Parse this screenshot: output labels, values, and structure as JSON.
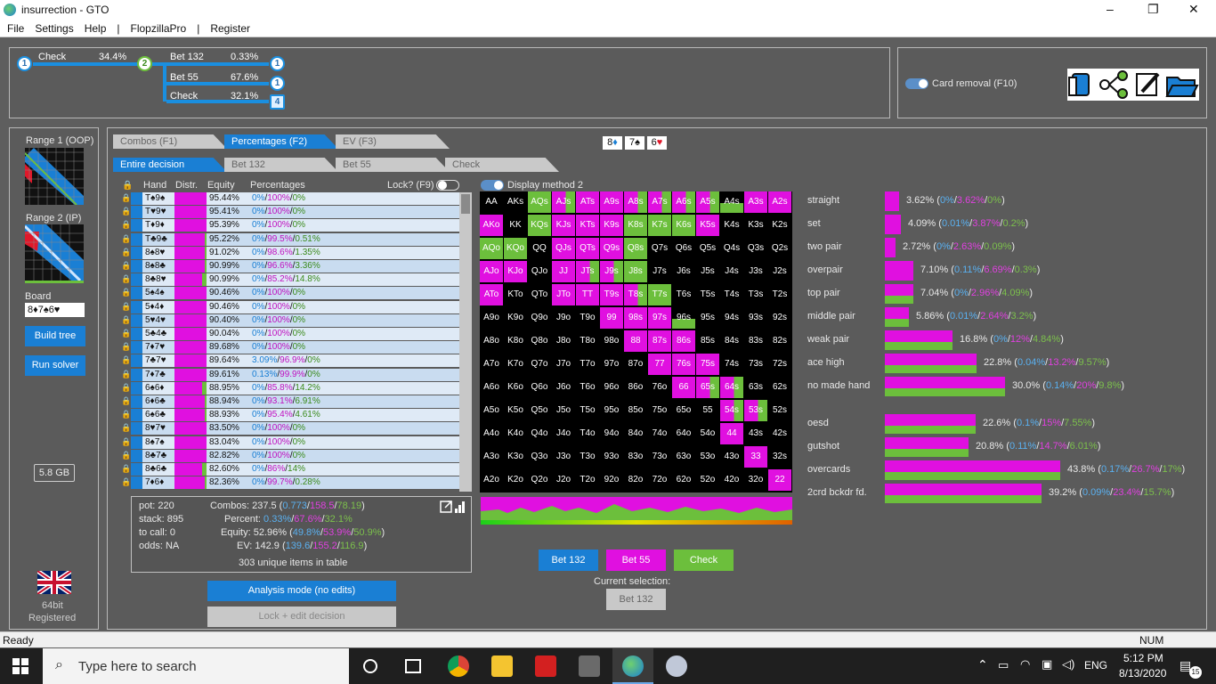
{
  "window": {
    "title": "insurrection - GTO",
    "min": "–",
    "max": "❐",
    "close": "✕"
  },
  "menu": [
    "File",
    "Settings",
    "Help",
    "|",
    "FlopzillaPro",
    "|",
    "Register"
  ],
  "tree": {
    "root_action": "Check",
    "root_freq": "34.4%",
    "node1": "1",
    "node2": "2",
    "branches": [
      {
        "label": "Bet 132",
        "freq": "0.33%",
        "node": "1"
      },
      {
        "label": "Bet 55",
        "freq": "67.6%",
        "node": "1"
      },
      {
        "label": "Check",
        "freq": "32.1%",
        "node": "4"
      }
    ]
  },
  "card_removal": "Card removal (F10)",
  "left": {
    "range1": "Range 1 (OOP)",
    "range2": "Range 2 (IP)",
    "board_label": "Board",
    "board_value": "8♦7♠6♥",
    "build_tree": "Build tree",
    "run_solver": "Run solver",
    "memory": "5.8 GB",
    "bit": "64bit",
    "registered": "Registered"
  },
  "tabs1": [
    "Combos (F1)",
    "Percentages (F2)",
    "EV (F3)"
  ],
  "tabs2": [
    "Entire decision",
    "Bet 132",
    "Bet 55",
    "Check"
  ],
  "board_cards": [
    {
      "rank": "8",
      "suit": "♦",
      "color": "#1a7fd4"
    },
    {
      "rank": "7",
      "suit": "♠",
      "color": "#111"
    },
    {
      "rank": "6",
      "suit": "♥",
      "color": "#e0182a"
    }
  ],
  "table": {
    "headers": [
      "Hand",
      "Distr.",
      "Equity",
      "Percentages",
      "Lock? (F9)"
    ],
    "rows": [
      {
        "hand": "T♠9♠",
        "eq": "95.44%",
        "p": [
          "0%",
          "100%",
          "0%"
        ]
      },
      {
        "hand": "T♥9♥",
        "eq": "95.41%",
        "p": [
          "0%",
          "100%",
          "0%"
        ]
      },
      {
        "hand": "T♦9♦",
        "eq": "95.39%",
        "p": [
          "0%",
          "100%",
          "0%"
        ]
      },
      {
        "hand": "T♣9♣",
        "eq": "95.22%",
        "p": [
          "0%",
          "99.5%",
          "0.51%"
        ]
      },
      {
        "hand": "8♠8♥",
        "eq": "91.02%",
        "p": [
          "0%",
          "98.6%",
          "1.35%"
        ]
      },
      {
        "hand": "8♠8♣",
        "eq": "90.99%",
        "p": [
          "0%",
          "96.6%",
          "3.36%"
        ]
      },
      {
        "hand": "8♣8♥",
        "eq": "90.99%",
        "p": [
          "0%",
          "85.2%",
          "14.8%"
        ]
      },
      {
        "hand": "5♠4♠",
        "eq": "90.46%",
        "p": [
          "0%",
          "100%",
          "0%"
        ]
      },
      {
        "hand": "5♦4♦",
        "eq": "90.46%",
        "p": [
          "0%",
          "100%",
          "0%"
        ]
      },
      {
        "hand": "5♥4♥",
        "eq": "90.40%",
        "p": [
          "0%",
          "100%",
          "0%"
        ]
      },
      {
        "hand": "5♣4♣",
        "eq": "90.04%",
        "p": [
          "0%",
          "100%",
          "0%"
        ]
      },
      {
        "hand": "7♦7♥",
        "eq": "89.68%",
        "p": [
          "0%",
          "100%",
          "0%"
        ]
      },
      {
        "hand": "7♣7♥",
        "eq": "89.64%",
        "p": [
          "3.09%",
          "96.9%",
          "0%"
        ]
      },
      {
        "hand": "7♦7♣",
        "eq": "89.61%",
        "p": [
          "0.13%",
          "99.9%",
          "0%"
        ]
      },
      {
        "hand": "6♠6♦",
        "eq": "88.95%",
        "p": [
          "0%",
          "85.8%",
          "14.2%"
        ]
      },
      {
        "hand": "6♦6♣",
        "eq": "88.94%",
        "p": [
          "0%",
          "93.1%",
          "6.91%"
        ]
      },
      {
        "hand": "6♠6♣",
        "eq": "88.93%",
        "p": [
          "0%",
          "95.4%",
          "4.61%"
        ]
      },
      {
        "hand": "8♥7♥",
        "eq": "83.50%",
        "p": [
          "0%",
          "100%",
          "0%"
        ]
      },
      {
        "hand": "8♠7♠",
        "eq": "83.04%",
        "p": [
          "0%",
          "100%",
          "0%"
        ]
      },
      {
        "hand": "8♣7♣",
        "eq": "82.82%",
        "p": [
          "0%",
          "100%",
          "0%"
        ]
      },
      {
        "hand": "8♣6♣",
        "eq": "82.60%",
        "p": [
          "0%",
          "86%",
          "14%"
        ]
      },
      {
        "hand": "7♦6♦",
        "eq": "82.36%",
        "p": [
          "0%",
          "99.7%",
          "0.28%"
        ]
      }
    ]
  },
  "summary": {
    "pot": "pot: 220",
    "stack": "stack: 895",
    "tocall": "to call: 0",
    "odds": "odds: NA",
    "combos_lbl": "Combos:",
    "combos_total": "237.5",
    "combos": [
      "0.773",
      "158.5",
      "78.19"
    ],
    "percent_lbl": "Percent:",
    "percent": [
      "0.33%",
      "67.6%",
      "32.1%"
    ],
    "equity_lbl": "Equity:",
    "equity_total": "52.96%",
    "equity": [
      "49.8%",
      "53.9%",
      "50.9%"
    ],
    "ev_lbl": "EV:",
    "ev_total": "142.9",
    "ev": [
      "139.6",
      "155.2",
      "116.9"
    ],
    "unique": "303 unique items in table"
  },
  "analysis_btn": "Analysis mode (no edits)",
  "lock_btn": "Lock + edit decision",
  "display_method": "Display method 2",
  "grid_ranks": [
    "A",
    "K",
    "Q",
    "J",
    "T",
    "9",
    "8",
    "7",
    "6",
    "5",
    "4",
    "3",
    "2"
  ],
  "legend": {
    "bet132": "Bet 132",
    "bet55": "Bet 55",
    "check": "Check",
    "current": "Current selection:",
    "current_value": "Bet 132"
  },
  "colors": {
    "bet132": "#1a7fd4",
    "bet55": "#e010e0",
    "check": "#6cbf3c"
  },
  "stats": [
    {
      "name": "straight",
      "total": "3.62%",
      "p": [
        "0%",
        "3.62%",
        "0%"
      ],
      "frac": 0.036
    },
    {
      "name": "set",
      "total": "4.09%",
      "p": [
        "0.01%",
        "3.87%",
        "0.2%"
      ],
      "frac": 0.041
    },
    {
      "name": "two pair",
      "total": "2.72%",
      "p": [
        "0%",
        "2.63%",
        "0.09%"
      ],
      "frac": 0.027
    },
    {
      "name": "overpair",
      "total": "7.10%",
      "p": [
        "0.11%",
        "6.69%",
        "0.3%"
      ],
      "frac": 0.071
    },
    {
      "name": "top pair",
      "total": "7.04%",
      "p": [
        "0%",
        "2.96%",
        "4.09%"
      ],
      "frac": 0.07
    },
    {
      "name": "middle pair",
      "total": "5.86%",
      "p": [
        "0.01%",
        "2.64%",
        "3.2%"
      ],
      "frac": 0.059
    },
    {
      "name": "weak pair",
      "total": "16.8%",
      "p": [
        "0%",
        "12%",
        "4.84%"
      ],
      "frac": 0.168
    },
    {
      "name": "ace high",
      "total": "22.8%",
      "p": [
        "0.04%",
        "13.2%",
        "9.57%"
      ],
      "frac": 0.228
    },
    {
      "name": "no made hand",
      "total": "30.0%",
      "p": [
        "0.14%",
        "20%",
        "9.8%"
      ],
      "frac": 0.3
    },
    {
      "name": "oesd",
      "total": "22.6%",
      "p": [
        "0.1%",
        "15%",
        "7.55%"
      ],
      "frac": 0.226
    },
    {
      "name": "gutshot",
      "total": "20.8%",
      "p": [
        "0.11%",
        "14.7%",
        "6.01%"
      ],
      "frac": 0.208
    },
    {
      "name": "overcards",
      "total": "43.8%",
      "p": [
        "0.17%",
        "26.7%",
        "17%"
      ],
      "frac": 0.438
    },
    {
      "name": "2crd bckdr fd.",
      "total": "39.2%",
      "p": [
        "0.09%",
        "23.4%",
        "15.7%"
      ],
      "frac": 0.392
    }
  ],
  "status": {
    "left": "Ready",
    "right": "NUM"
  },
  "taskbar": {
    "search": "Type here to search",
    "lang": "ENG",
    "time": "5:12 PM",
    "date": "8/13/2020",
    "notif": "15"
  }
}
